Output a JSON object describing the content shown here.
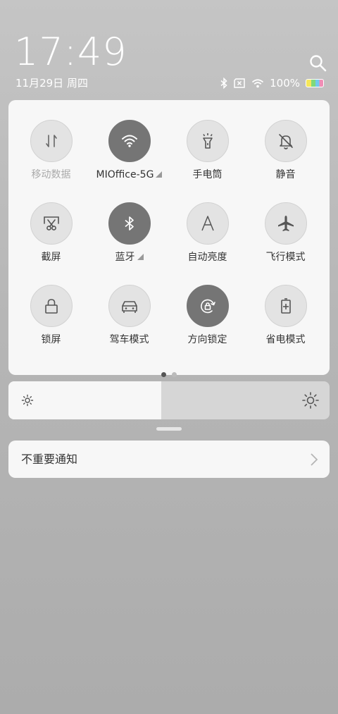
{
  "status": {
    "time": "17:49",
    "date": "11月29日 周四",
    "battery_percent": "100%",
    "battery_level": 1.0
  },
  "quick_tiles": [
    {
      "label": "移动数据",
      "icon": "mobile-data-icon",
      "active": false,
      "disabled": true,
      "has_submenu": false
    },
    {
      "label": "MIOffice-5G",
      "icon": "wifi-icon",
      "active": true,
      "disabled": false,
      "has_submenu": true
    },
    {
      "label": "手电筒",
      "icon": "flashlight-icon",
      "active": false,
      "disabled": false,
      "has_submenu": false
    },
    {
      "label": "静音",
      "icon": "mute-bell-icon",
      "active": false,
      "disabled": false,
      "has_submenu": false
    },
    {
      "label": "截屏",
      "icon": "screenshot-icon",
      "active": false,
      "disabled": false,
      "has_submenu": false
    },
    {
      "label": "蓝牙",
      "icon": "bluetooth-icon",
      "active": true,
      "disabled": false,
      "has_submenu": true
    },
    {
      "label": "自动亮度",
      "icon": "auto-brightness-icon",
      "active": false,
      "disabled": false,
      "has_submenu": false
    },
    {
      "label": "飞行模式",
      "icon": "airplane-icon",
      "active": false,
      "disabled": false,
      "has_submenu": false
    },
    {
      "label": "锁屏",
      "icon": "lock-icon",
      "active": false,
      "disabled": false,
      "has_submenu": false
    },
    {
      "label": "驾车模式",
      "icon": "car-icon",
      "active": false,
      "disabled": false,
      "has_submenu": false
    },
    {
      "label": "方向锁定",
      "icon": "rotation-lock-icon",
      "active": true,
      "disabled": false,
      "has_submenu": false
    },
    {
      "label": "省电模式",
      "icon": "battery-saver-icon",
      "active": false,
      "disabled": false,
      "has_submenu": false
    }
  ],
  "pager": {
    "pages": 2,
    "current": 0
  },
  "brightness": {
    "level": 0.475
  },
  "notification": {
    "label": "不重要通知"
  },
  "colors": {
    "tile_active": "#757575",
    "tile_inactive": "#e3e3e3",
    "panel": "#f7f7f7",
    "dot_active": "#555555",
    "dot_inactive": "#bbbbbb"
  }
}
